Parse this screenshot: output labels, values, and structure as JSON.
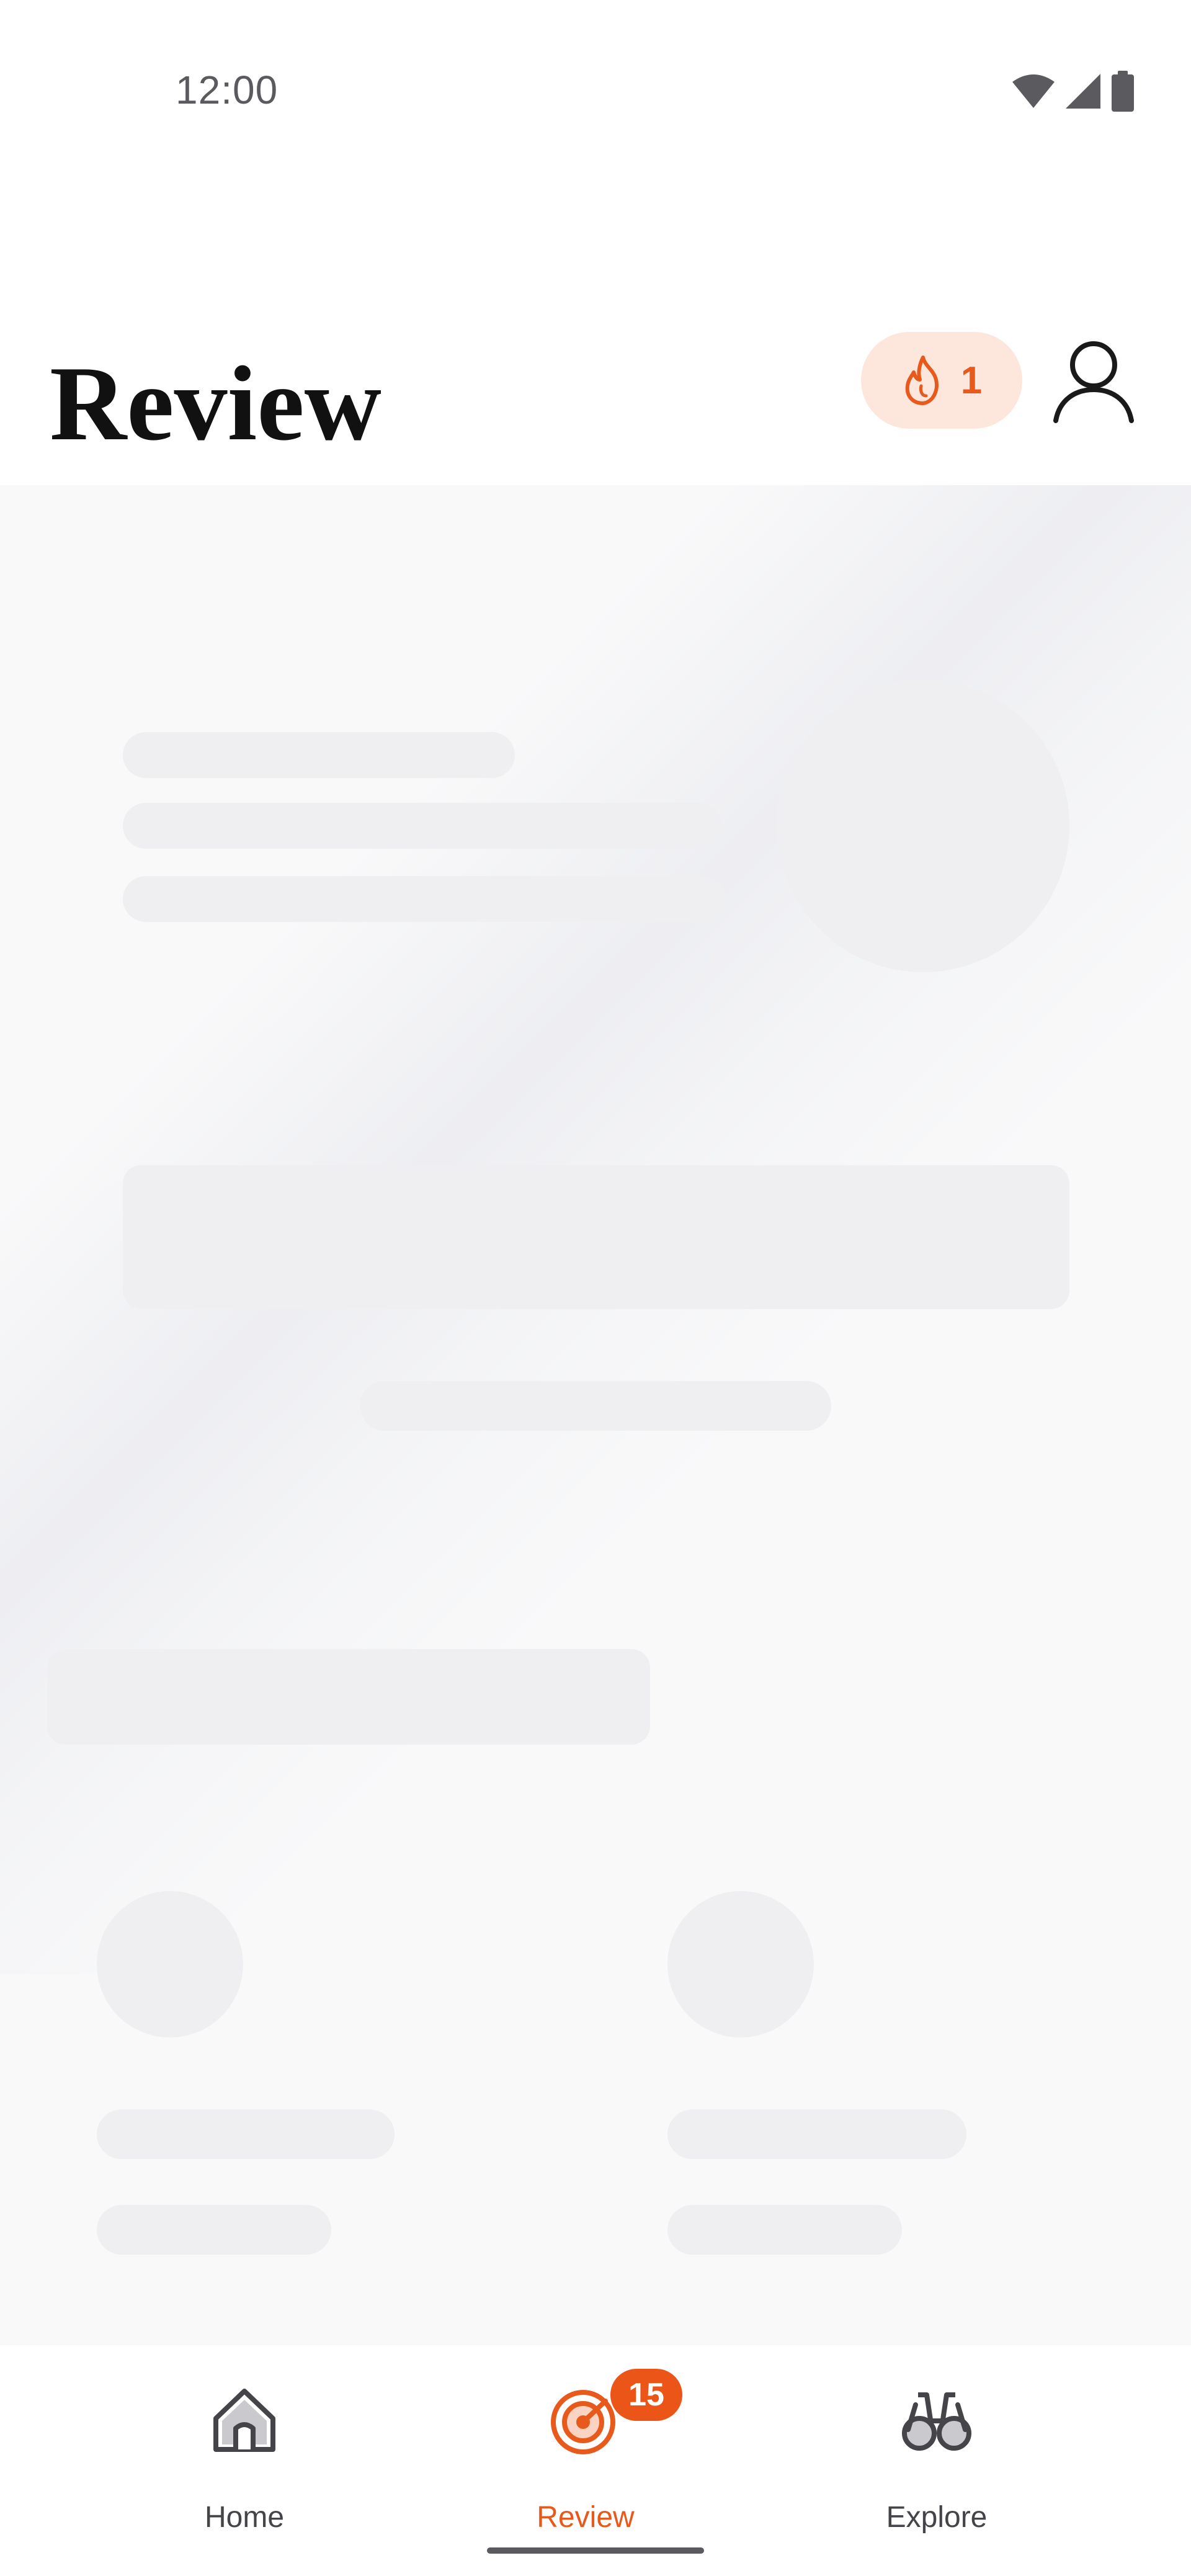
{
  "status_bar": {
    "time": "12:00",
    "icons": [
      "wifi-icon",
      "cellular-signal-icon",
      "battery-icon"
    ]
  },
  "header": {
    "title": "Review",
    "streak": {
      "icon": "flame-icon",
      "count": "1"
    },
    "profile_icon": "user-icon"
  },
  "content": {
    "state": "loading"
  },
  "bottom_nav": {
    "items": [
      {
        "label": "Home",
        "icon": "home-icon",
        "active": false
      },
      {
        "label": "Review",
        "icon": "target-icon",
        "active": true,
        "badge": "15"
      },
      {
        "label": "Explore",
        "icon": "binoculars-icon",
        "active": false
      }
    ]
  },
  "colors": {
    "accent": "#e8591c",
    "badge_bg": "#ec5518",
    "streak_bg": "#fde6dc",
    "skeleton": "#efeff2",
    "content_bg": "#f9f9fa"
  }
}
